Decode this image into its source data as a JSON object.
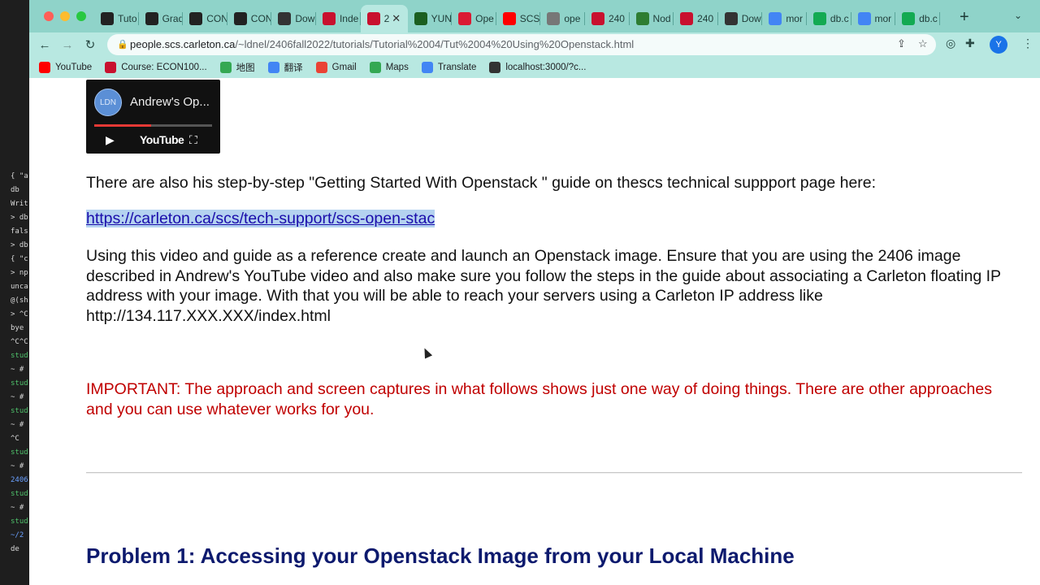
{
  "terminal": {
    "lines": [
      "{ \"a",
      "db",
      "Writ",
      "> db",
      "fals",
      "> db",
      "{ \"c",
      "> np",
      "unca",
      "@(sh",
      "> ^C",
      "bye",
      "^C^C",
      "stud",
      "~ #",
      "stud",
      "~ #",
      "stud",
      "~ #",
      "^C",
      "stud",
      "~ #",
      "2406",
      "stud",
      "~ #",
      "stud",
      "~/2",
      "de"
    ]
  },
  "browser": {
    "tabs": [
      {
        "label": "Tuto",
        "icon": "d2l-icon",
        "color": "#222222"
      },
      {
        "label": "Grad",
        "icon": "d2l-icon",
        "color": "#222222"
      },
      {
        "label": "CON",
        "icon": "d2l-icon",
        "color": "#222222"
      },
      {
        "label": "CON",
        "icon": "d2l-icon",
        "color": "#222222"
      },
      {
        "label": "Dow",
        "icon": "globe-icon",
        "color": "#333333"
      },
      {
        "label": "Inde",
        "icon": "carleton-shield-icon",
        "color": "#c8102e"
      },
      {
        "label": "2",
        "icon": "carleton-shield-icon",
        "color": "#c8102e",
        "active": true
      },
      {
        "label": "YUN",
        "icon": "grid-icon",
        "color": "#1b5e20"
      },
      {
        "label": "Ope",
        "icon": "openstack-icon",
        "color": "#da1a32"
      },
      {
        "label": "SCS",
        "icon": "youtube-icon",
        "color": "#ff0000"
      },
      {
        "label": "ope",
        "icon": "globe-icon",
        "color": "#777777"
      },
      {
        "label": "240",
        "icon": "carleton-shield-icon",
        "color": "#c8102e"
      },
      {
        "label": "Nod",
        "icon": "w-icon",
        "color": "#2e7d32"
      },
      {
        "label": "240",
        "icon": "carleton-shield-icon",
        "color": "#c8102e"
      },
      {
        "label": "Dow",
        "icon": "globe-icon",
        "color": "#333333"
      },
      {
        "label": "mor",
        "icon": "google-icon",
        "color": "#4285f4"
      },
      {
        "label": "db.c",
        "icon": "mongodb-icon",
        "color": "#13aa52"
      },
      {
        "label": "mor",
        "icon": "google-icon",
        "color": "#4285f4"
      },
      {
        "label": "db.c",
        "icon": "mongodb-icon",
        "color": "#13aa52"
      }
    ],
    "new_tab": "+",
    "url_host": "people.scs.carleton.ca",
    "url_path": "/~ldnel/2406fall2022/tutorials/Tutorial%2004/Tut%2004%20Using%20Openstack.html",
    "profile_initial": "Y",
    "bookmarks": [
      {
        "label": "YouTube",
        "icon": "youtube-icon",
        "color": "#ff0000"
      },
      {
        "label": "Course: ECON100...",
        "icon": "carleton-shield-icon",
        "color": "#c8102e"
      },
      {
        "label": "地图",
        "icon": "maps-pin-icon",
        "color": "#34a853"
      },
      {
        "label": "翻译",
        "icon": "translate-icon",
        "color": "#4285f4"
      },
      {
        "label": "Gmail",
        "icon": "gmail-icon",
        "color": "#ea4335"
      },
      {
        "label": "Maps",
        "icon": "maps-pin-icon",
        "color": "#34a853"
      },
      {
        "label": "Translate",
        "icon": "translate-icon",
        "color": "#4285f4"
      },
      {
        "label": "localhost:3000/?c...",
        "icon": "globe-icon",
        "color": "#333333"
      }
    ]
  },
  "video": {
    "channel_initials": "LDN",
    "title": "Andrew's Op...",
    "youtube_label": "YouTube"
  },
  "content": {
    "para1": "There are also his step-by-step \"Getting Started With Openstack \" guide on thescs technical suppport page here:",
    "link": "https://carleton.ca/scs/tech-support/scs-open-stac",
    "para2": "Using this video and guide as a reference create and launch an Openstack image. Ensure that you are using the 2406 image described in Andrew's YouTube video and also make sure you follow the steps in the guide about associating a Carleton floating IP address with your image. With that you will be able to reach your servers using a Carleton IP address like http://134.117.XXX.XXX/index.html",
    "important": "IMPORTANT: The approach and screen captures in what follows shows just one way of doing things. There are other approaches and you can use whatever works for you.",
    "heading": "Problem 1: Accessing your Openstack Image from your Local Machine"
  }
}
